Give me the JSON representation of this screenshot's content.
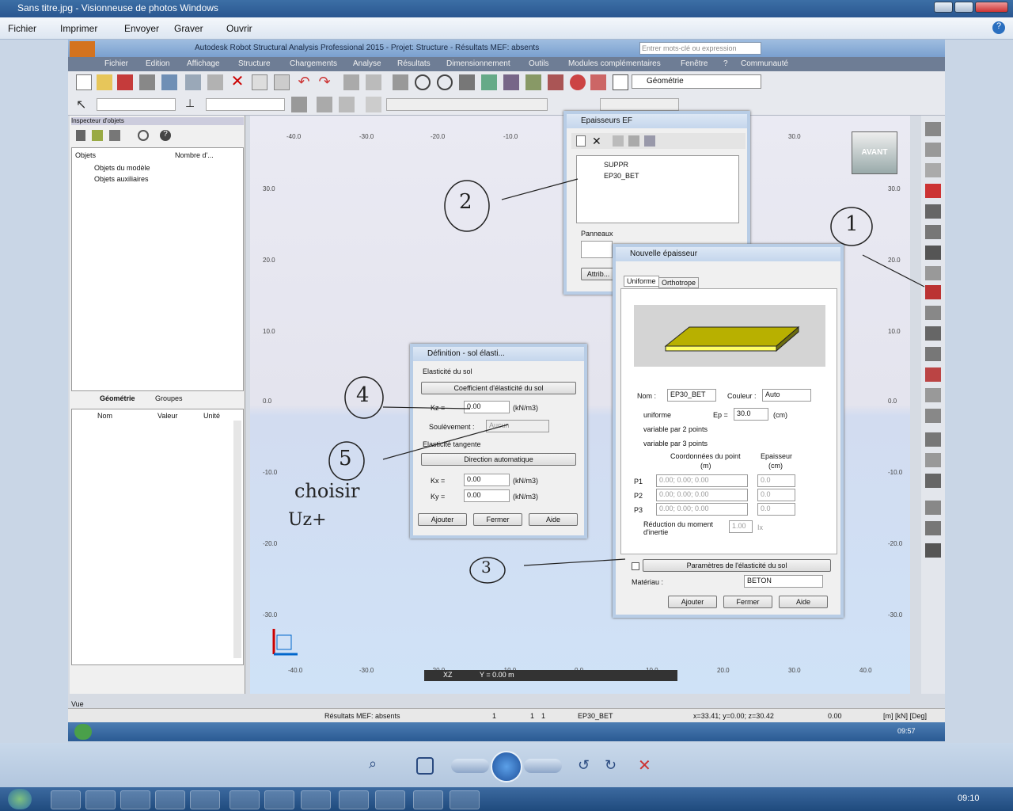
{
  "viewer": {
    "title": "Sans titre.jpg - Visionneuse de photos Windows",
    "menu": [
      "Fichier",
      "Imprimer",
      "Envoyer",
      "Graver",
      "Ouvrir"
    ]
  },
  "robot": {
    "title": "Autodesk Robot Structural Analysis Professional 2015 - Projet: Structure - Résultats MEF: absents",
    "search_placeholder": "Entrer mots-clé ou expression",
    "menu": [
      "Fichier",
      "Edition",
      "Affichage",
      "Structure",
      "Chargements",
      "Analyse",
      "Résultats",
      "Dimensionnement",
      "Outils",
      "Modules complémentaires",
      "Fenêtre",
      "?",
      "Communauté"
    ],
    "geometry_select": "Géométrie",
    "colors": {
      "menu": "#6e7d95",
      "canvas_upper": "#e6e6f0",
      "canvas_lower": "#cfe2f7",
      "plate": "#b8b000"
    }
  },
  "inspector": {
    "title": "Inspecteur d'objets",
    "col_objects": "Objets",
    "col_name": "Nombre d'...",
    "items": [
      "Objets du modèle",
      "Objets auxiliaires"
    ],
    "tabs": [
      "Géométrie",
      "Groupes"
    ],
    "props_cols": [
      "Nom",
      "Valeur",
      "Unité"
    ]
  },
  "canvas": {
    "top_ticks": [
      "-40.0",
      "-30.0",
      "-20.0",
      "-10.0",
      "30.0"
    ],
    "bottom_ticks": [
      "-40.0",
      "-30.0",
      "-20.0",
      "-10.0",
      "0.0",
      "10.0",
      "20.0",
      "30.0",
      "40.0"
    ],
    "left_ticks": [
      "30.0",
      "20.0",
      "10.0",
      "0.0",
      "-10.0",
      "-20.0",
      "-30.0"
    ],
    "right_ticks": [
      "30.0",
      "20.0",
      "10.0",
      "0.0",
      "-10.0",
      "-20.0",
      "-30.0"
    ],
    "view_label": "AVANT",
    "xz_label": "XZ",
    "y_readout": "Y = 0.00 m"
  },
  "thickness_dialog": {
    "title": "Epaisseurs EF",
    "items": [
      "SUPPR",
      "EP30_BET"
    ],
    "panels_label": "Panneaux",
    "apply_label": "Attrib..."
  },
  "new_thickness": {
    "title": "Nouvelle épaisseur",
    "tabs": [
      "Uniforme",
      "Orthotrope"
    ],
    "name_label": "Nom :",
    "name_value": "EP30_BET",
    "color_label": "Couleur :",
    "color_value": "Auto",
    "options": [
      "uniforme",
      "variable par 2 points",
      "variable par 3 points"
    ],
    "ep_label": "Ep =",
    "ep_value": "30.0",
    "ep_unit": "(cm)",
    "coords_header": "Coordonnées du point",
    "coords_unit": "(m)",
    "thk_header": "Epaisseur",
    "thk_unit": "(cm)",
    "points": [
      {
        "label": "P1",
        "coord": "0.00; 0.00; 0.00",
        "thk": "0.0"
      },
      {
        "label": "P2",
        "coord": "0.00; 0.00; 0.00",
        "thk": "0.0"
      },
      {
        "label": "P3",
        "coord": "0.00; 0.00; 0.00",
        "thk": "0.0"
      }
    ],
    "reduction_label": "Réduction du moment d'inertie",
    "reduction_value": "1.00",
    "reduction_unit": "Ix",
    "soil_button": "Paramètres de l'élasticité du sol",
    "material_label": "Matériau :",
    "material_value": "BETON",
    "buttons": [
      "Ajouter",
      "Fermer",
      "Aide"
    ]
  },
  "soil_dialog": {
    "title": "Définition - sol élasti...",
    "section1": "Elasticité du sol",
    "coef_button": "Coefficient d'élasticité du sol",
    "kz_label": "Kz =",
    "kz_value": "0.00",
    "unit": "(kN/m3)",
    "uplift_label": "Soulèvement :",
    "uplift_value": "Aucun",
    "section2": "Elasticité tangente",
    "auto_button": "Direction automatique",
    "kx_label": "Kx =",
    "kx_value": "0.00",
    "ky_label": "Ky =",
    "ky_value": "0.00",
    "buttons": [
      "Ajouter",
      "Fermer",
      "Aide"
    ]
  },
  "annotations": {
    "n1": "1",
    "n2": "2",
    "n3": "3",
    "n4": "4",
    "n5": "5",
    "note1": "choisir",
    "note2": "Uz+"
  },
  "status": {
    "view": "Vue",
    "results": "Résultats MEF: absents",
    "v1": "1",
    "v2": "1",
    "v3": "1",
    "thickness": "EP30_BET",
    "coords": "x=33.41; y=0.00; z=30.42",
    "angle": "0.00",
    "units": "[m] [kN] [Deg]"
  },
  "inner_clock": "09:57",
  "clock": "09:10"
}
